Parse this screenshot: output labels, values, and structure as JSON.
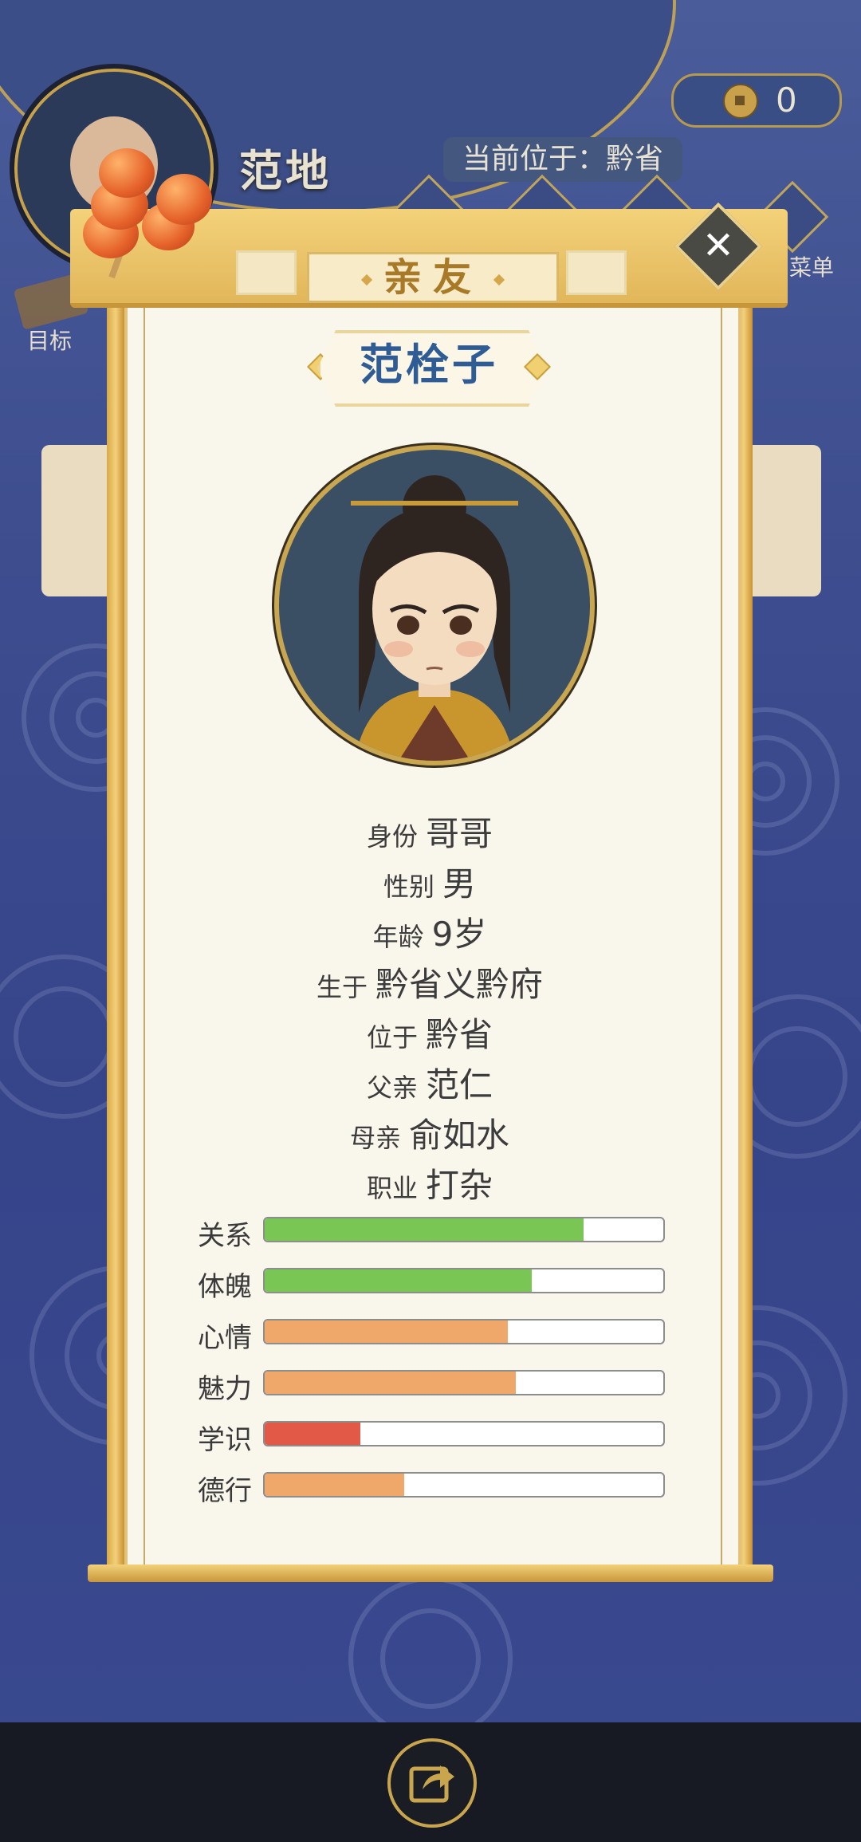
{
  "hud": {
    "player_name": "范地",
    "location_text": "当前位于：黔省",
    "coins": "0",
    "target_label": "目标",
    "menu_label": "菜单"
  },
  "dialog": {
    "title": "亲友",
    "close_symbol": "✕",
    "character_name": "范栓子",
    "info": [
      {
        "key": "身份",
        "value": "哥哥"
      },
      {
        "key": "性别",
        "value": "男"
      },
      {
        "key": "年龄",
        "value": "9岁"
      },
      {
        "key": "生于",
        "value": "黔省义黔府"
      },
      {
        "key": "位于",
        "value": "黔省"
      },
      {
        "key": "父亲",
        "value": "范仁"
      },
      {
        "key": "母亲",
        "value": "俞如水"
      },
      {
        "key": "职业",
        "value": "打杂"
      }
    ],
    "stats": [
      {
        "label": "关系",
        "fraction": 0.8,
        "color": "#7ac655"
      },
      {
        "label": "体魄",
        "fraction": 0.67,
        "color": "#7ac655"
      },
      {
        "label": "心情",
        "fraction": 0.61,
        "color": "#efa86a"
      },
      {
        "label": "魅力",
        "fraction": 0.63,
        "color": "#efa86a"
      },
      {
        "label": "学识",
        "fraction": 0.24,
        "color": "#e25a47"
      },
      {
        "label": "德行",
        "fraction": 0.35,
        "color": "#efa86a"
      }
    ]
  },
  "icons": {
    "share": "share-icon",
    "close": "close-icon",
    "coin": "coin-icon"
  }
}
